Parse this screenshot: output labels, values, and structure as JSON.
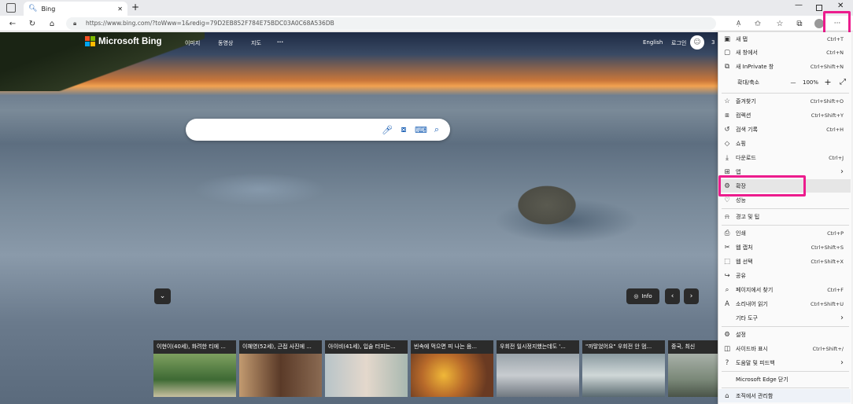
{
  "browser": {
    "tab_title": "Bing",
    "url": "https://www.bing.com/?toWww=1&redig=79D2EB852F784E75BDC03A0C68A536DB",
    "read_aloud_icon": "A̩"
  },
  "bing": {
    "logo_text": "Microsoft Bing",
    "nav": [
      "이미지",
      "동영상",
      "지도",
      "···"
    ],
    "lang": "English",
    "login": "로그인",
    "rewards": "3",
    "info_label": "Info",
    "news": [
      {
        "caption": "이현이(40세), 화려한 티에 ..."
      },
      {
        "caption": "이혜영(52세), 근접 사진에 ..."
      },
      {
        "caption": "아이비(41세), 입술 터지는..."
      },
      {
        "caption": "빈속에 먹으면 피 나는 음..."
      },
      {
        "caption": "우회전 일시정지했는데도 '..."
      },
      {
        "caption": "\"까맣었어요\" 우회전 안 멈..."
      },
      {
        "caption": "중국, 최신"
      }
    ]
  },
  "menu": {
    "items": [
      {
        "icon": "new-tab-icon",
        "glyph": "▣",
        "label": "새 탭",
        "shortcut": "Ctrl+T"
      },
      {
        "icon": "new-window-icon",
        "glyph": "▢",
        "label": "새 창에서",
        "shortcut": "Ctrl+N"
      },
      {
        "icon": "inprivate-icon",
        "glyph": "⧉",
        "label": "새 InPrivate 창",
        "shortcut": "Ctrl+Shift+N"
      },
      {
        "icon": "favorites-icon",
        "glyph": "☆",
        "label": "즐겨찾기",
        "shortcut": "Ctrl+Shift+O"
      },
      {
        "icon": "collections-icon",
        "glyph": "⧈",
        "label": "컴렉션",
        "shortcut": "Ctrl+Shift+Y"
      },
      {
        "icon": "history-icon",
        "glyph": "↺",
        "label": "검색 기록",
        "shortcut": "Ctrl+H"
      },
      {
        "icon": "shopping-icon",
        "glyph": "◇",
        "label": "쇼핑",
        "shortcut": ""
      },
      {
        "icon": "download-icon",
        "glyph": "⤓",
        "label": "다운로드",
        "shortcut": "Ctrl+J"
      },
      {
        "icon": "apps-icon",
        "glyph": "⊞",
        "label": "앱",
        "shortcut": "›"
      },
      {
        "icon": "extensions-icon",
        "glyph": "⚙",
        "label": "확장",
        "shortcut": ""
      },
      {
        "icon": "performance-icon",
        "glyph": "♡",
        "label": "성능",
        "shortcut": ""
      },
      {
        "icon": "alerts-icon",
        "glyph": "⍾",
        "label": "경고 및 팁",
        "shortcut": ""
      },
      {
        "icon": "print-icon",
        "glyph": "⎙",
        "label": "인쇄",
        "shortcut": "Ctrl+P"
      },
      {
        "icon": "web-capture-icon",
        "glyph": "✂",
        "label": "웹 캡처",
        "shortcut": "Ctrl+Shift+S"
      },
      {
        "icon": "web-select-icon",
        "glyph": "⬚",
        "label": "웹 선택",
        "shortcut": "Ctrl+Shift+X"
      },
      {
        "icon": "share-icon",
        "glyph": "↪",
        "label": "공유",
        "shortcut": ""
      },
      {
        "icon": "find-icon",
        "glyph": "⌕",
        "label": "페이지에서 찾기",
        "shortcut": "Ctrl+F"
      },
      {
        "icon": "read-aloud-icon",
        "glyph": "A",
        "label": "소리내어 읽기",
        "shortcut": "Ctrl+Shift+U"
      },
      {
        "icon": "more-tools-icon",
        "glyph": "",
        "label": "기타 도구",
        "shortcut": "›"
      },
      {
        "icon": "settings-icon",
        "glyph": "⚙",
        "label": "설정",
        "shortcut": ""
      },
      {
        "icon": "sidebar-icon",
        "glyph": "◫",
        "label": "사이드바 표시",
        "shortcut": "Ctrl+Shift+/"
      },
      {
        "icon": "help-icon",
        "glyph": "?",
        "label": "도움말 및 피드백",
        "shortcut": "›"
      },
      {
        "icon": "",
        "glyph": "",
        "label": "Microsoft Edge 닫기",
        "shortcut": ""
      },
      {
        "icon": "briefcase-icon",
        "glyph": "⌂",
        "label": "조직에서 관리함",
        "shortcut": ""
      }
    ],
    "zoom": {
      "label": "확대/축소",
      "minus": "—",
      "value": "100%",
      "plus": "+",
      "expand": "⤢"
    }
  },
  "colors": {
    "highlight": "#ec1c8d",
    "accent": "#1a5fb4"
  }
}
